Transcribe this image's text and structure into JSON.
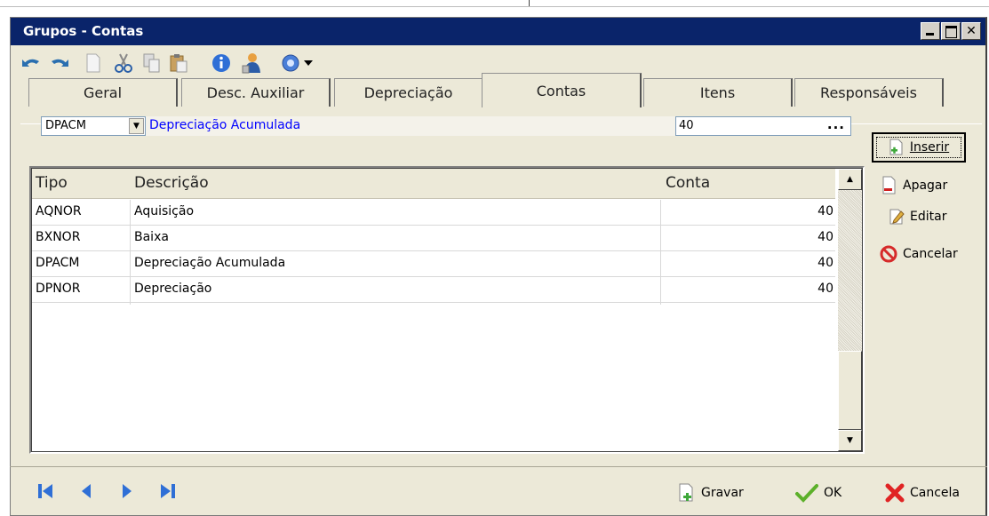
{
  "window": {
    "title": "Grupos - Contas"
  },
  "toolbar": {
    "icons": [
      "undo-icon",
      "redo-icon",
      "new-doc-icon",
      "cut-icon",
      "copy-icon",
      "paste-icon",
      "info-icon",
      "user-icon",
      "help-icon",
      "dropdown-arrow-icon"
    ]
  },
  "tabs": [
    {
      "label": "Geral",
      "active": false
    },
    {
      "label": "Desc. Auxiliar",
      "active": false
    },
    {
      "label": "Depreciação",
      "active": false
    },
    {
      "label": "Contas",
      "active": true
    },
    {
      "label": "Itens",
      "active": false
    },
    {
      "label": "Responsáveis",
      "active": false
    }
  ],
  "filter": {
    "code": "DPACM",
    "description": "Depreciação Acumulada",
    "conta": "40",
    "lookup": "..."
  },
  "actions": {
    "inserir": "Inserir",
    "apagar": "Apagar",
    "editar": "Editar",
    "cancelar": "Cancelar"
  },
  "grid": {
    "headers": {
      "tipo": "Tipo",
      "descricao": "Descrição",
      "conta": "Conta"
    },
    "rows": [
      {
        "tipo": "AQNOR",
        "descricao": "Aquisição",
        "conta": "40"
      },
      {
        "tipo": "BXNOR",
        "descricao": "Baixa",
        "conta": "40"
      },
      {
        "tipo": "DPACM",
        "descricao": "Depreciação Acumulada",
        "conta": "40"
      },
      {
        "tipo": "DPNOR",
        "descricao": "Depreciação",
        "conta": "40"
      }
    ]
  },
  "footer": {
    "gravar": "Gravar",
    "ok": "OK",
    "cancela": "Cancela"
  },
  "colors": {
    "titlebar": "#0a246a",
    "link": "#0000ff",
    "face": "#ece9d8"
  }
}
